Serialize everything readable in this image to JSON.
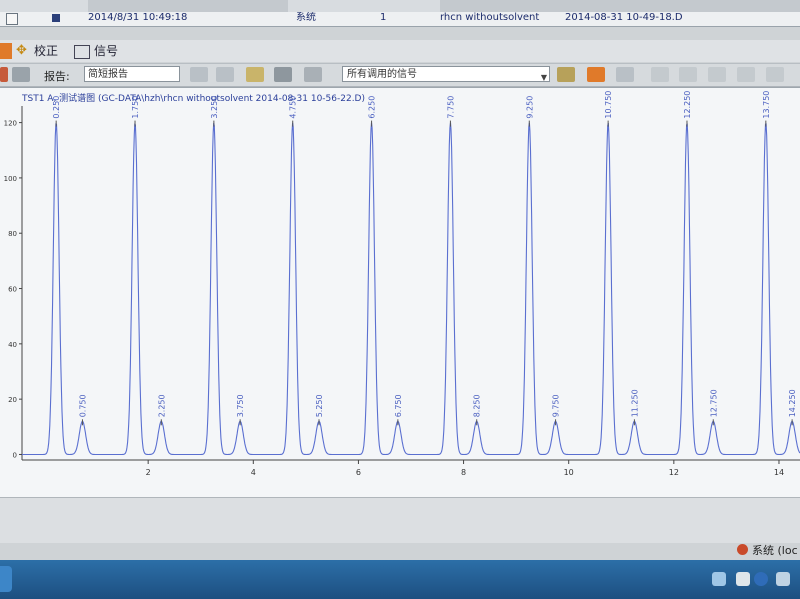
{
  "table": {
    "row1": {
      "index": "1",
      "datetime": "2014/8/31 10:49:18",
      "type": "系统",
      "count": "1",
      "name": "rhcn withoutsolvent",
      "acq": "2014-08-31   10-49-18.D"
    }
  },
  "menubar": {
    "calibrate_label": "校正",
    "signal_label": "信号"
  },
  "toolbar": {
    "report_label": "报告:",
    "report_value": "简短报告",
    "signal_value": "所有调用的信号"
  },
  "plot": {
    "title": "TST1 A, 测试谱图 (GC-DATA\\hzh\\rhcn withoutsolvent  2014-08-31   10-56-22.D)"
  },
  "chart_data": {
    "type": "line",
    "title": "TST1 A, 测试谱图 (GC-DATA\\hzh\\rhcn withoutsolvent  2014-08-31   10-56-22.D)",
    "xlabel": "",
    "ylabel": "",
    "xlim": [
      -0.4,
      14.4
    ],
    "ylim": [
      -2,
      126
    ],
    "xticks": [
      2,
      4,
      6,
      8,
      10,
      12,
      14
    ],
    "yticks": [
      0,
      20,
      40,
      60,
      80,
      100,
      120
    ],
    "peaks": [
      {
        "rt": "0.250",
        "x": 0.25,
        "height": 120
      },
      {
        "rt": "0.750",
        "x": 0.75,
        "height": 12
      },
      {
        "rt": "1.750",
        "x": 1.75,
        "height": 120
      },
      {
        "rt": "2.250",
        "x": 2.25,
        "height": 12
      },
      {
        "rt": "3.250",
        "x": 3.25,
        "height": 120
      },
      {
        "rt": "3.750",
        "x": 3.75,
        "height": 12
      },
      {
        "rt": "4.750",
        "x": 4.75,
        "height": 120
      },
      {
        "rt": "5.250",
        "x": 5.25,
        "height": 12
      },
      {
        "rt": "6.250",
        "x": 6.25,
        "height": 120
      },
      {
        "rt": "6.750",
        "x": 6.75,
        "height": 12
      },
      {
        "rt": "7.750",
        "x": 7.75,
        "height": 120
      },
      {
        "rt": "8.250",
        "x": 8.25,
        "height": 12
      },
      {
        "rt": "9.250",
        "x": 9.25,
        "height": 120
      },
      {
        "rt": "9.750",
        "x": 9.75,
        "height": 12
      },
      {
        "rt": "10.750",
        "x": 10.75,
        "height": 120
      },
      {
        "rt": "11.250",
        "x": 11.25,
        "height": 12
      },
      {
        "rt": "12.250",
        "x": 12.25,
        "height": 120
      },
      {
        "rt": "12.750",
        "x": 12.75,
        "height": 12
      },
      {
        "rt": "13.750",
        "x": 13.75,
        "height": 120
      },
      {
        "rt": "14.250",
        "x": 14.25,
        "height": 12
      }
    ],
    "grid": false,
    "line_color": "#5a6fd0"
  },
  "status": {
    "text": "系统 (loc"
  }
}
